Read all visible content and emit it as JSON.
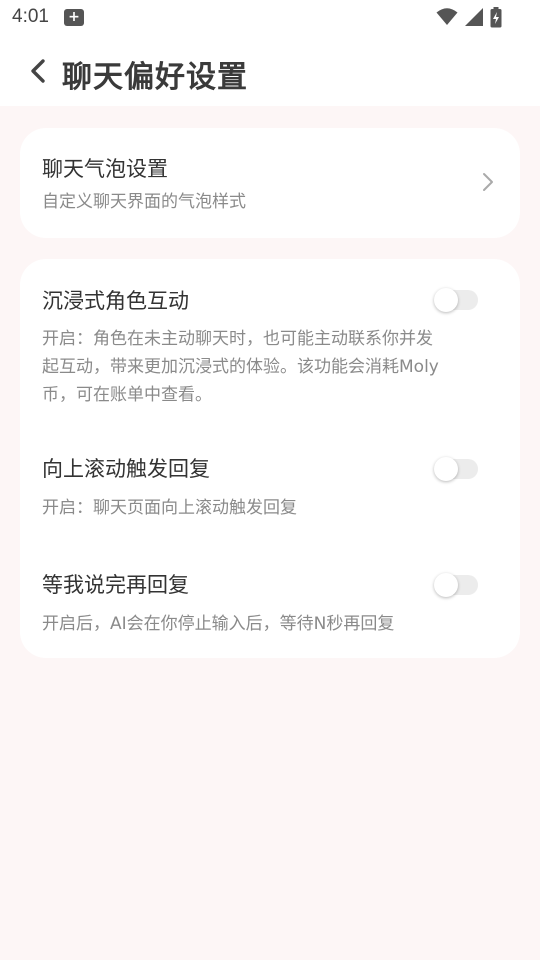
{
  "status_bar": {
    "time": "4:01",
    "notification_icon": "plus-box-icon",
    "icons": [
      "wifi-icon",
      "cellular-signal-icon",
      "battery-charging-icon"
    ]
  },
  "header": {
    "back_icon": "chevron-left-icon",
    "title": "聊天偏好设置"
  },
  "bubble_setting": {
    "title": "聊天气泡设置",
    "description": "自定义聊天界面的气泡样式",
    "chevron_icon": "chevron-right-icon"
  },
  "options": [
    {
      "title": "沉浸式角色互动",
      "description_line1": "开启：角色在未主动聊天时，也可能主动联系你并发",
      "description_line2": "起互动，带来更加沉浸式的体验。该功能会消耗Moly",
      "description_line3": "币，可在账单中查看。",
      "enabled": false
    },
    {
      "title": "向上滚动触发回复",
      "description": "开启：聊天页面向上滚动触发回复",
      "enabled": false
    },
    {
      "title": "等我说完再回复",
      "description": "开启后，AI会在你停止输入后，等待N秒再回复",
      "enabled": false
    }
  ],
  "colors": {
    "page_background": "#fdf6f6",
    "card_background": "#ffffff",
    "title_text": "#333333",
    "description_text": "#8a8a8a",
    "toggle_off_track": "#ececec"
  }
}
